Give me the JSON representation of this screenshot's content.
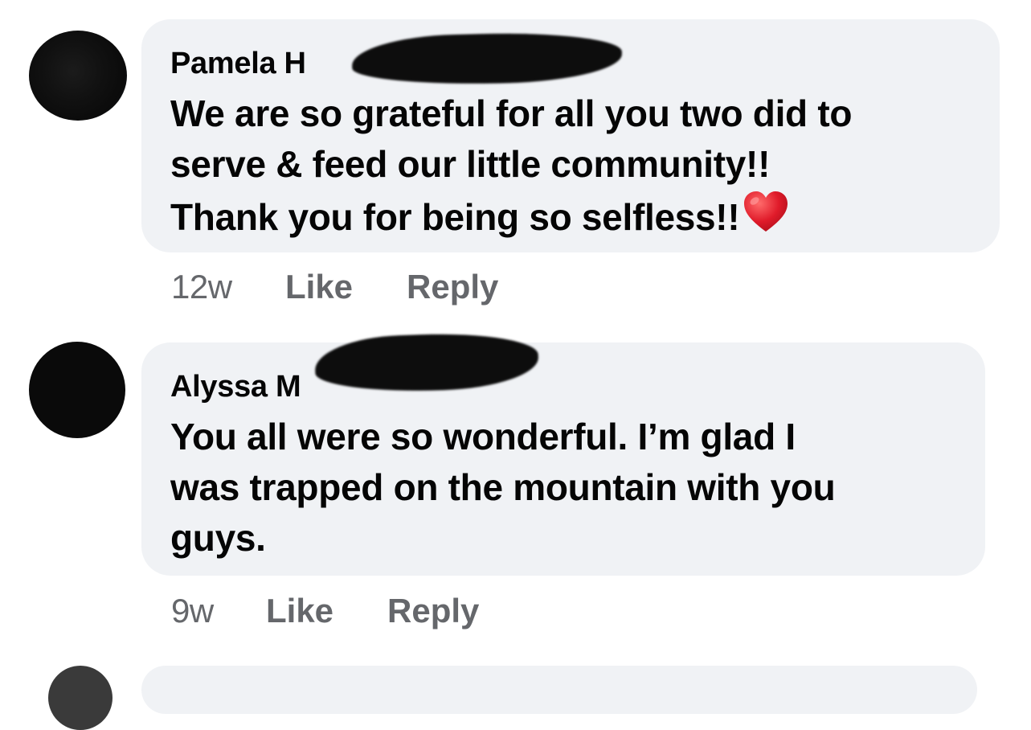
{
  "comments": [
    {
      "author_visible": "Pamela H",
      "text_lines": [
        "We are so grateful for all you two did to",
        "serve & feed our little community!!",
        "Thank you for being so selfless!!"
      ],
      "emoji": "red-heart",
      "time": "12w",
      "like_label": "Like",
      "reply_label": "Reply"
    },
    {
      "author_visible": "Alyssa M",
      "text_lines": [
        "You all were so wonderful. I’m glad I",
        "was trapped on the mountain with you",
        "guys."
      ],
      "time": "9w",
      "like_label": "Like",
      "reply_label": "Reply"
    }
  ],
  "colors": {
    "bubble": "#f0f2f5",
    "text": "#050505",
    "meta": "#65676b",
    "heart": "#e0245e"
  }
}
